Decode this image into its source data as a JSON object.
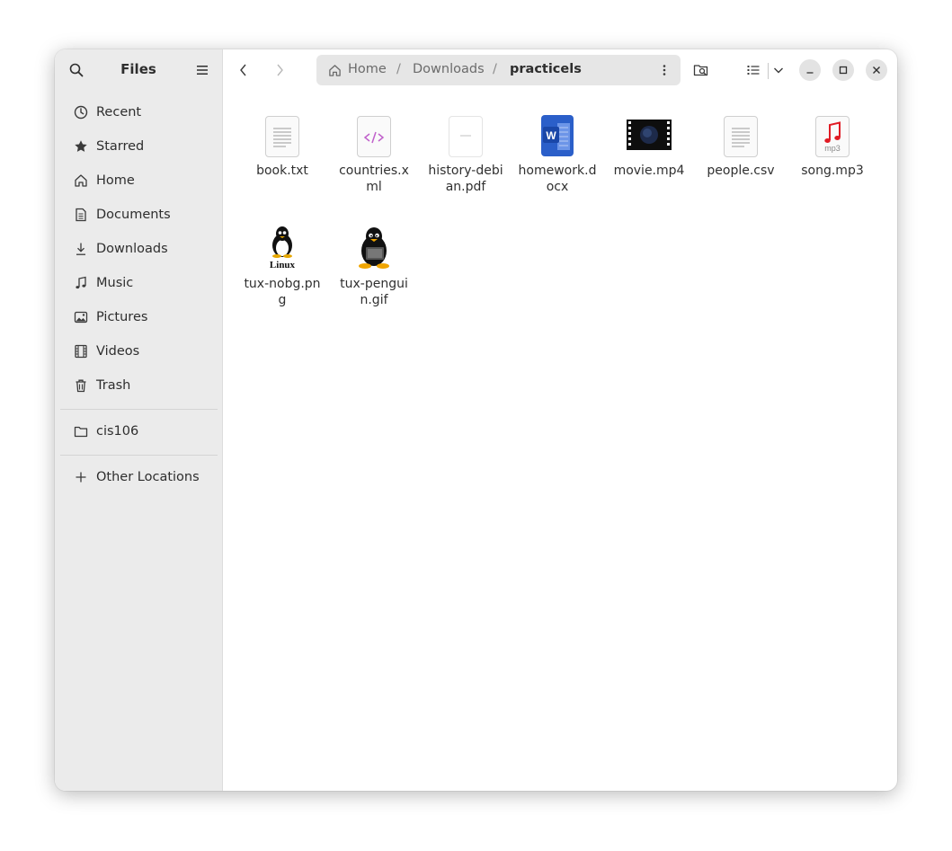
{
  "app": {
    "title": "Files"
  },
  "sidebar": {
    "items": [
      {
        "label": "Recent",
        "icon": "clock-icon"
      },
      {
        "label": "Starred",
        "icon": "star-icon"
      },
      {
        "label": "Home",
        "icon": "home-icon"
      },
      {
        "label": "Documents",
        "icon": "document-icon"
      },
      {
        "label": "Downloads",
        "icon": "download-icon"
      },
      {
        "label": "Music",
        "icon": "music-icon"
      },
      {
        "label": "Pictures",
        "icon": "image-icon"
      },
      {
        "label": "Videos",
        "icon": "film-icon"
      },
      {
        "label": "Trash",
        "icon": "trash-icon"
      }
    ],
    "bookmarks": [
      {
        "label": "cis106",
        "icon": "folder-icon"
      }
    ],
    "other": {
      "label": "Other Locations",
      "icon": "plus-icon"
    }
  },
  "pathbar": {
    "crumbs": [
      "Home",
      "Downloads",
      "practicels"
    ],
    "separator": "/"
  },
  "files": [
    {
      "name": "book.txt",
      "type": "text"
    },
    {
      "name": "countries.xml",
      "type": "xml"
    },
    {
      "name": "history-debian.pdf",
      "type": "pdf"
    },
    {
      "name": "homework.docx",
      "type": "docx"
    },
    {
      "name": "movie.mp4",
      "type": "video"
    },
    {
      "name": "people.csv",
      "type": "text"
    },
    {
      "name": "song.mp3",
      "type": "audio",
      "badge": "mp3"
    },
    {
      "name": "tux-nobg.png",
      "type": "image",
      "caption": "Linux"
    },
    {
      "name": "tux-penguin.gif",
      "type": "image"
    }
  ],
  "colors": {
    "sidebar_bg": "#ebebeb",
    "pathbar_bg": "#e6e6e6",
    "xml_accent": "#c061cb",
    "word_blue": "#2b5fc9",
    "audio_red": "#e01b24"
  }
}
